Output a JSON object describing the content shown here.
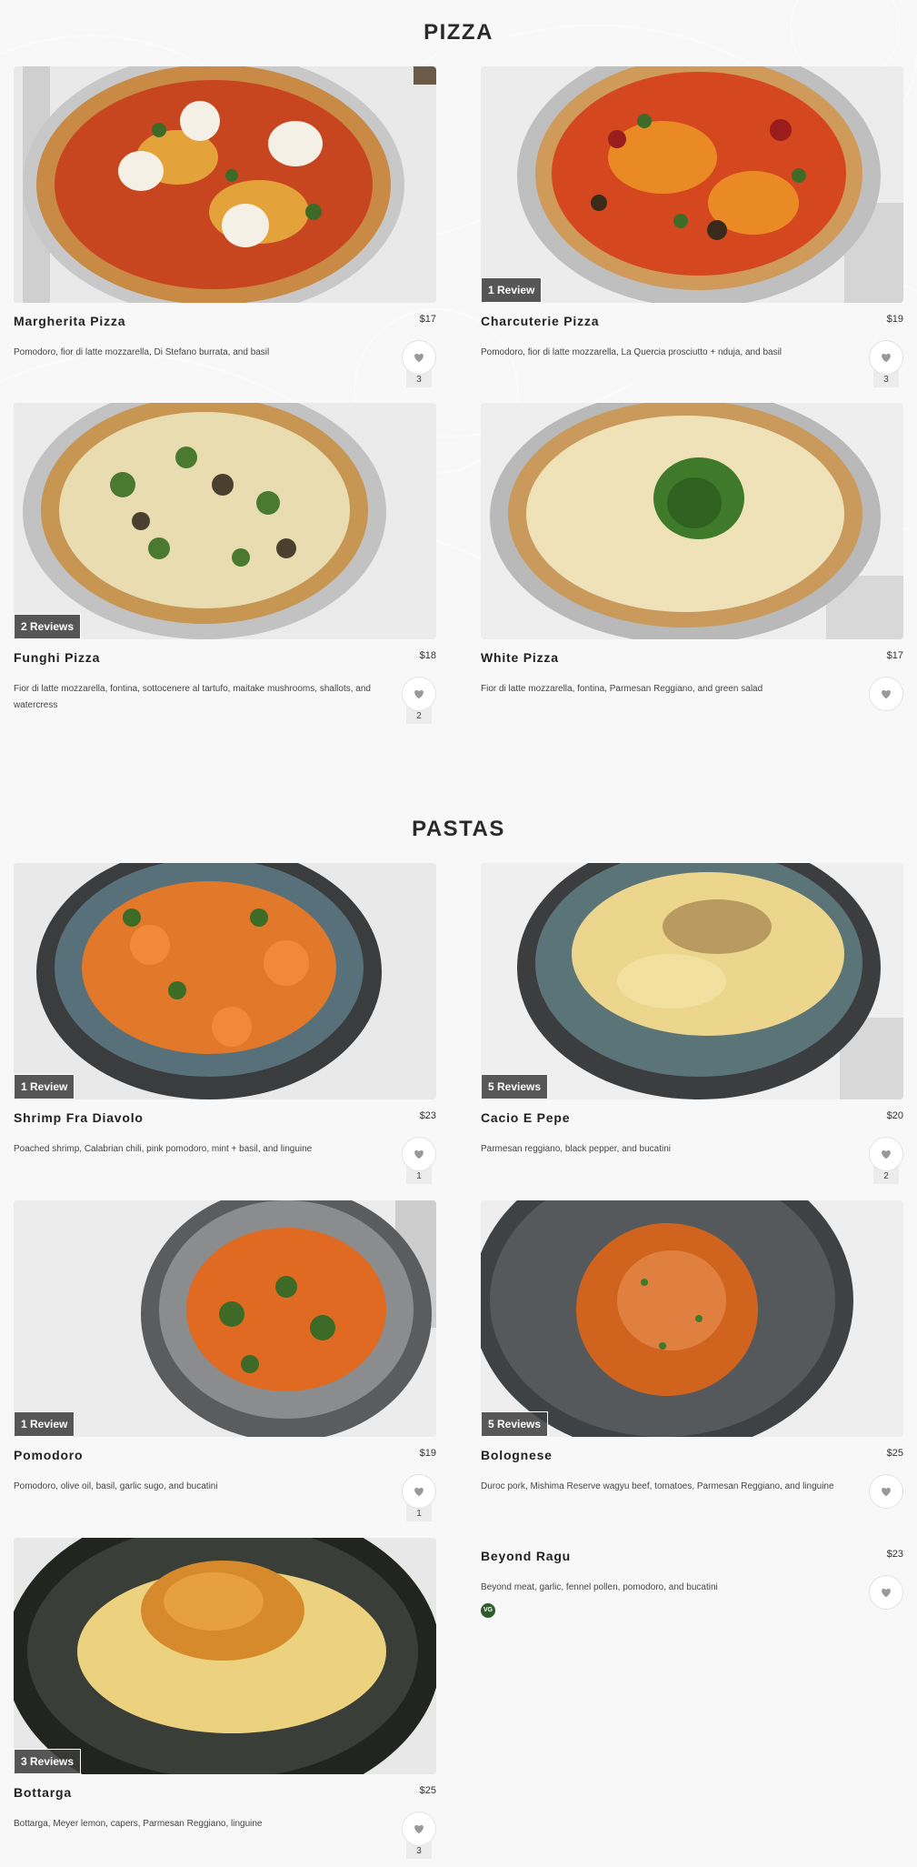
{
  "sections": [
    {
      "title": "PIZZA",
      "items": [
        {
          "name": "Margherita Pizza",
          "price": "$17",
          "description": "Pomodoro, fior di latte mozzarella, Di Stefano burrata, and basil",
          "reviews": "",
          "likes": "3"
        },
        {
          "name": "Charcuterie Pizza",
          "price": "$19",
          "description": "Pomodoro, fior di latte mozzarella, La Quercia prosciutto + nduja, and basil",
          "reviews": "1 Review",
          "likes": "3"
        },
        {
          "name": "Funghi Pizza",
          "price": "$18",
          "description": "Fior di latte mozzarella, fontina, sottocenere al tartufo, maitake mushrooms, shallots, and watercress",
          "reviews": "2 Reviews",
          "likes": "2"
        },
        {
          "name": "White Pizza",
          "price": "$17",
          "description": "Fior di latte mozzarella, fontina, Parmesan Reggiano, and green salad",
          "reviews": "",
          "likes": ""
        }
      ]
    },
    {
      "title": "PASTAS",
      "items": [
        {
          "name": "Shrimp Fra Diavolo",
          "price": "$23",
          "description": "Poached shrimp, Calabrian chili, pink pomodoro, mint + basil, and linguine",
          "reviews": "1 Review",
          "likes": "1"
        },
        {
          "name": "Cacio E Pepe",
          "price": "$20",
          "description": "Parmesan reggiano, black pepper, and bucatini",
          "reviews": "5 Reviews",
          "likes": "2"
        },
        {
          "name": "Pomodoro",
          "price": "$19",
          "description": "Pomodoro, olive oil, basil, garlic sugo, and bucatini",
          "reviews": "1 Review",
          "likes": "1"
        },
        {
          "name": "Bolognese",
          "price": "$25",
          "description": "Duroc pork, Mishima Reserve wagyu beef, tomatoes, Parmesan Reggiano, and linguine",
          "reviews": "5 Reviews",
          "likes": ""
        },
        {
          "name": "Bottarga",
          "price": "$25",
          "description": "Bottarga, Meyer lemon, capers, Parmesan Reggiano, linguine",
          "reviews": "3 Reviews",
          "likes": "3"
        },
        {
          "name": "Beyond Ragu",
          "price": "$23",
          "description": "Beyond meat, garlic, fennel pollen, pomodoro, and bucatini",
          "reviews": "",
          "likes": "",
          "badge": "VG"
        }
      ]
    }
  ],
  "icons": {
    "like": "heart-icon",
    "vegan": "vegan-badge-icon"
  },
  "colors": {
    "background": "#f8f8f8",
    "badge_bg": "#3c3c3c",
    "vegan_green": "#2e5a2e"
  }
}
